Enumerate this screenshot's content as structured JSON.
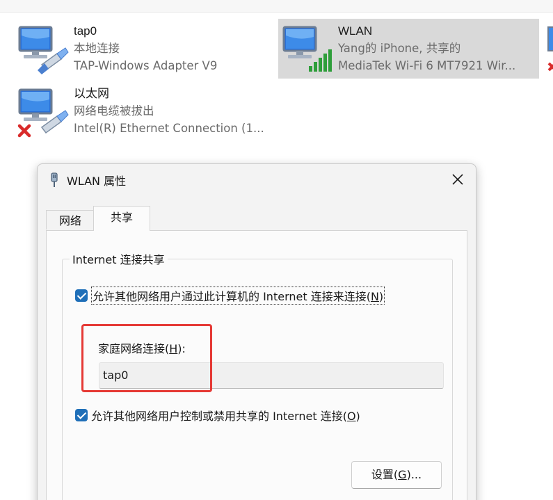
{
  "adapters": [
    {
      "name": "tap0",
      "status": "本地连接",
      "device": "TAP-Windows Adapter V9",
      "selected": false
    },
    {
      "name": "WLAN",
      "status": "Yang的 iPhone, 共享的",
      "device": "MediaTek Wi-Fi 6 MT7921 Wir...",
      "selected": true
    },
    {
      "name": "以太网",
      "status": "网络电缆被拔出",
      "device": "Intel(R) Ethernet Connection (1...",
      "selected": false
    }
  ],
  "dialog": {
    "title": "WLAN 属性",
    "tabs": [
      {
        "label": "网络",
        "active": false
      },
      {
        "label": "共享",
        "active": true
      }
    ],
    "group_title": "Internet 连接共享",
    "allow_sharing": {
      "label_pre": "允许其他网络用户通过此计算机的 Internet 连接来连接(",
      "accel": "N",
      "label_post": ")",
      "checked": true
    },
    "home_network": {
      "label_pre": "家庭网络连接(",
      "accel": "H",
      "label_post": "):",
      "value": "tap0"
    },
    "allow_control": {
      "label_pre": "允许其他网络用户控制或禁用共享的 Internet 连接(",
      "accel": "O",
      "label_post": ")",
      "checked": true
    },
    "settings_button": {
      "label_pre": "设置(",
      "accel": "G",
      "label_post": ")..."
    }
  },
  "colors": {
    "accent": "#1f6fb8",
    "highlight_box": "#e53935",
    "selected_tile": "#d9d9d9"
  }
}
